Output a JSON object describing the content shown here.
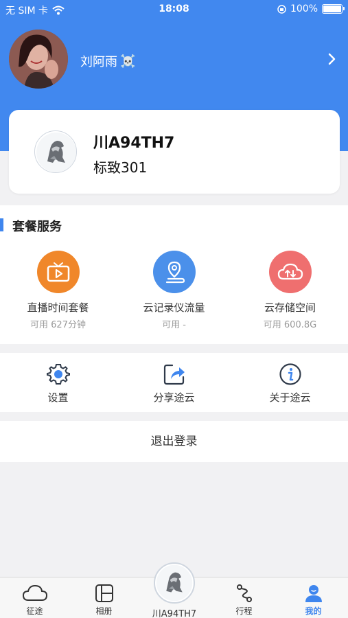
{
  "status_bar": {
    "carrier": "无 SIM 卡",
    "time": "18:08",
    "battery": "100%"
  },
  "profile": {
    "name": "刘阿雨",
    "name_emoji": "☠️"
  },
  "car": {
    "plate": "川A94TH7",
    "model": "标致301"
  },
  "services": {
    "title": "套餐服务",
    "items": [
      {
        "name": "直播时间套餐",
        "sub": "可用 627分钟",
        "color": "#f0872a",
        "icon": "tv-icon"
      },
      {
        "name": "云记录仪流量",
        "sub": "可用 -",
        "color": "#4b90ea",
        "icon": "location-pin-icon"
      },
      {
        "name": "云存储空间",
        "sub": "可用 600.8G",
        "color": "#ef6f6f",
        "icon": "cloud-sync-icon"
      }
    ]
  },
  "tools": [
    {
      "label": "设置",
      "icon": "gear-icon"
    },
    {
      "label": "分享途云",
      "icon": "share-icon"
    },
    {
      "label": "关于途云",
      "icon": "info-icon"
    }
  ],
  "logout_label": "退出登录",
  "tabbar": {
    "tabs": [
      {
        "label": "征途",
        "icon": "cloud-icon"
      },
      {
        "label": "相册",
        "icon": "album-icon"
      },
      {
        "label": "川A94TH7",
        "icon": "car-logo"
      },
      {
        "label": "行程",
        "icon": "route-icon"
      },
      {
        "label": "我的",
        "icon": "user-icon",
        "active": true
      }
    ]
  },
  "colors": {
    "primary": "#4188ef",
    "accent": "#3f86ee"
  }
}
